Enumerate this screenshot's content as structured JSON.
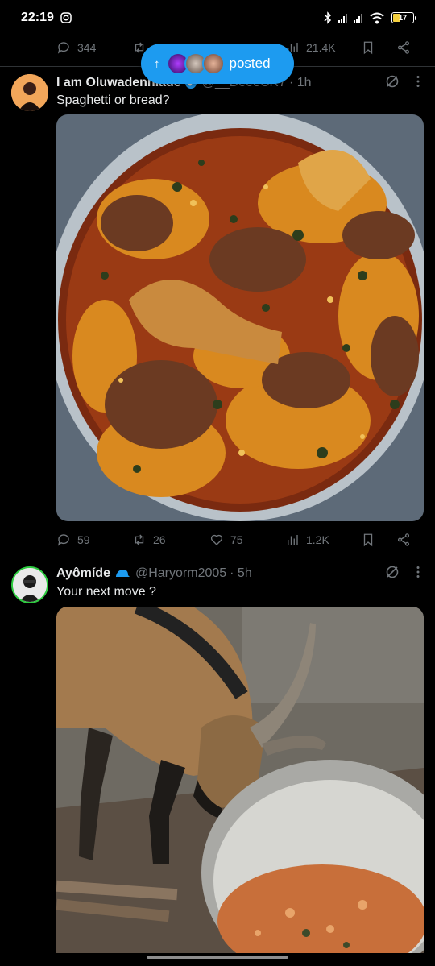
{
  "status_bar": {
    "time": "22:19",
    "battery": "17"
  },
  "top_actions": {
    "replies": "344",
    "views": "21.4K"
  },
  "posted_pill": {
    "label": "posted",
    "arrow": "↑"
  },
  "tweets": [
    {
      "name": "I am Oluwadenniade",
      "handle": "@__DeeeCR7",
      "time": "· 1h",
      "text": "Spaghetti or bread?",
      "stats": {
        "replies": "59",
        "reposts": "26",
        "likes": "75",
        "views": "1.2K"
      }
    },
    {
      "name": "Ayômíde",
      "handle": "@Haryorm2005",
      "time": "· 5h",
      "text": "Your next move ?"
    }
  ],
  "colors": {
    "accent": "#1d9bf0",
    "muted": "#71767b",
    "divider": "#2f3336"
  }
}
